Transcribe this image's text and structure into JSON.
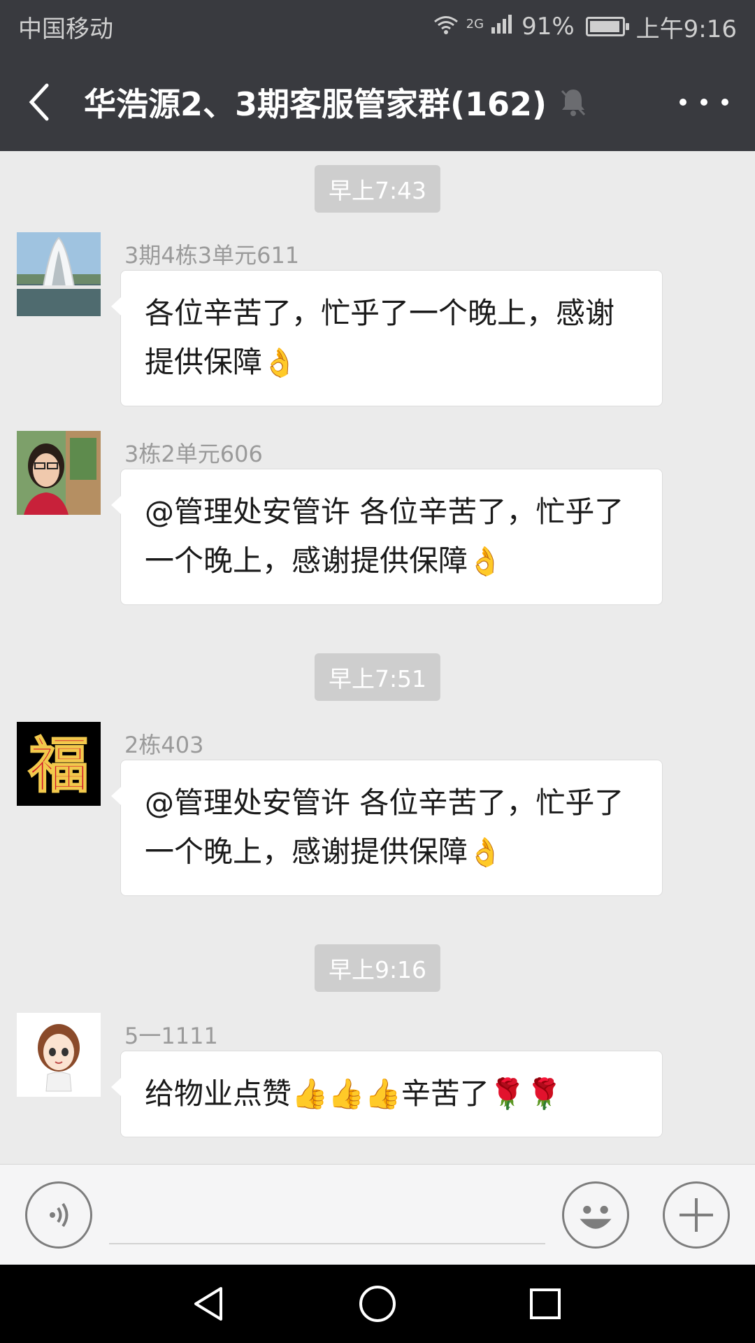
{
  "status_bar": {
    "carrier": "中国移动",
    "network": "2G",
    "battery_text": "91%",
    "time": "上午9:16"
  },
  "header": {
    "title": "华浩源2、3期客服管家群(162)",
    "back_icon": "chevron-left-icon",
    "mute_icon": "bell-off-icon",
    "more_icon": "more-dots-icon"
  },
  "messages": [
    {
      "type": "time",
      "text": "早上7:43"
    },
    {
      "type": "msg",
      "sender": "3期4栋3单元611",
      "text": "各位辛苦了，忙乎了一个晚上，感谢提供保障",
      "emoji": "👌"
    },
    {
      "type": "msg",
      "sender": "3栋2单元606",
      "text": "@管理处安管许  各位辛苦了，忙乎了一个晚上，感谢提供保障",
      "emoji": "👌"
    },
    {
      "type": "time",
      "text": "早上7:51"
    },
    {
      "type": "msg",
      "sender": "2栋403",
      "text": "@管理处安管许  各位辛苦了，忙乎了一个晚上，感谢提供保障",
      "emoji": "👌"
    },
    {
      "type": "time",
      "text": "早上9:16"
    },
    {
      "type": "msg",
      "sender": "5一1111",
      "text": "给物业点赞👍👍👍辛苦了🌹🌹"
    }
  ],
  "avatars": {
    "a1": "福",
    "a_colors": {
      "red": "#c8102e"
    }
  },
  "input_bar": {
    "voice_icon": "voice-icon",
    "emoji_icon": "emoji-icon",
    "plus_icon": "plus-icon",
    "placeholder": ""
  },
  "nav": {
    "back": "back-triangle-icon",
    "home": "home-circle-icon",
    "recents": "recents-square-icon"
  }
}
